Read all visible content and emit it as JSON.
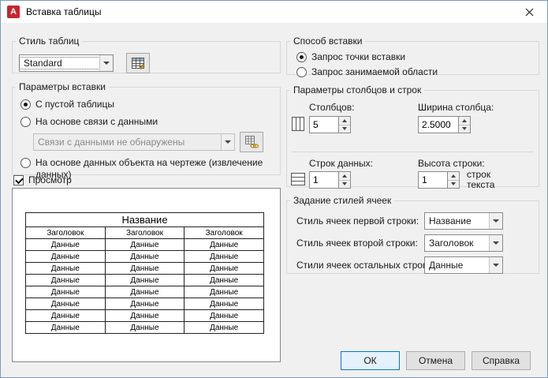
{
  "window": {
    "title": "Вставка таблицы",
    "logo_letter": "A"
  },
  "colors": {
    "accent_blue": "#0078d7",
    "logo_red": "#c8242c",
    "titlebar_bg": "#ffffff",
    "dialog_bg": "#f0f0f0"
  },
  "table_style": {
    "group_label": "Стиль таблиц",
    "selected": "Standard"
  },
  "insert_options": {
    "group_label": "Параметры вставки",
    "radio_empty_table": "С пустой таблицы",
    "radio_data_link": "На основе связи с данными",
    "data_link_value": "Связи с данными не обнаружены",
    "radio_object_data": "На основе данных объекта на чертеже (извлечение данных)"
  },
  "preview": {
    "checkbox_label": "Просмотр",
    "table": {
      "title": "Название",
      "headers": [
        "Заголовок",
        "Заголовок",
        "Заголовок"
      ],
      "rows": [
        [
          "Данные",
          "Данные",
          "Данные"
        ],
        [
          "Данные",
          "Данные",
          "Данные"
        ],
        [
          "Данные",
          "Данные",
          "Данные"
        ],
        [
          "Данные",
          "Данные",
          "Данные"
        ],
        [
          "Данные",
          "Данные",
          "Данные"
        ],
        [
          "Данные",
          "Данные",
          "Данные"
        ],
        [
          "Данные",
          "Данные",
          "Данные"
        ],
        [
          "Данные",
          "Данные",
          "Данные"
        ]
      ]
    }
  },
  "insert_behavior": {
    "group_label": "Способ вставки",
    "radio_point": "Запрос точки вставки",
    "radio_area": "Запрос занимаемой области"
  },
  "columns_rows": {
    "group_label": "Параметры столбцов и строк",
    "columns_label": "Столбцов:",
    "columns_value": "5",
    "column_width_label": "Ширина столбца:",
    "column_width_value": "2.5000",
    "data_rows_label": "Строк данных:",
    "data_rows_value": "1",
    "row_height_label": "Высота строки:",
    "row_height_value": "1",
    "row_height_suffix": "строк текста"
  },
  "cell_styles": {
    "group_label": "Задание стилей ячеек",
    "first_row_label": "Стиль ячеек первой строки:",
    "first_row_value": "Название",
    "second_row_label": "Стиль ячеек второй строки:",
    "second_row_value": "Заголовок",
    "other_rows_label": "Стили ячеек остальных строк:",
    "other_rows_value": "Данные"
  },
  "buttons": {
    "ok": "ОК",
    "cancel": "Отмена",
    "help": "Справка"
  }
}
